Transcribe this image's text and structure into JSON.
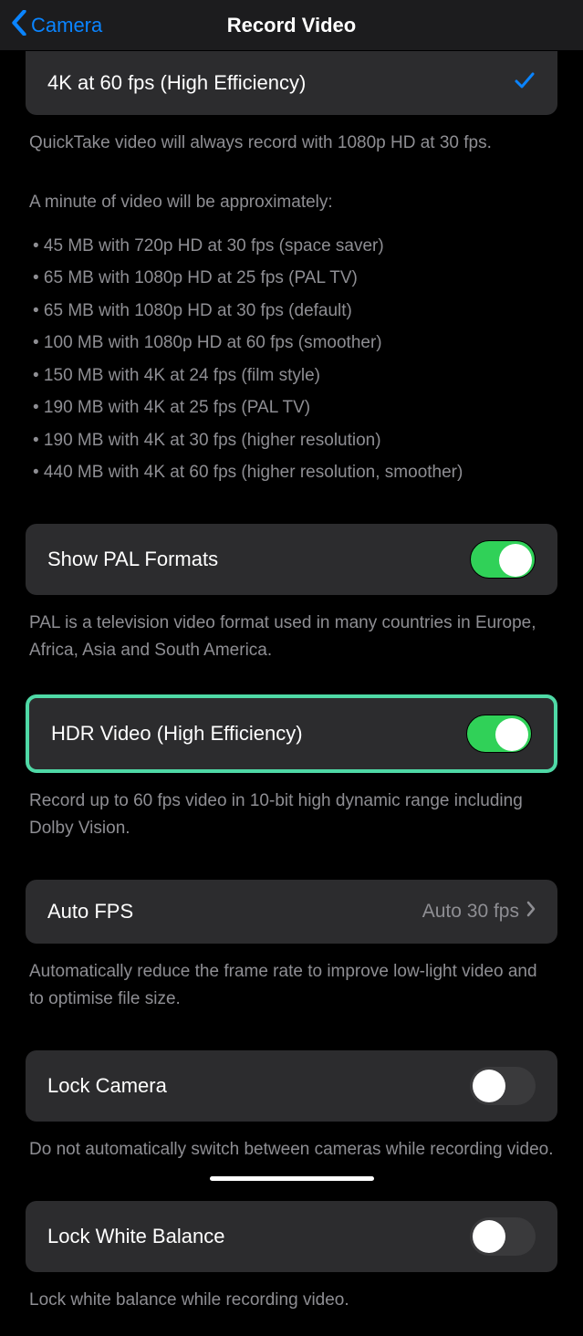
{
  "nav": {
    "back_label": "Camera",
    "title": "Record Video"
  },
  "selected_option": {
    "label": "4K at 60 fps (High Efficiency)"
  },
  "info": {
    "quicktake": "QuickTake video will always record with 1080p HD at 30 fps.",
    "intro": "A minute of video will be approximately:",
    "bullets": [
      "45 MB with 720p HD at 30 fps (space saver)",
      "65 MB with 1080p HD at 25 fps (PAL TV)",
      "65 MB with 1080p HD at 30 fps (default)",
      "100 MB with 1080p HD at 60 fps (smoother)",
      "150 MB with 4K at 24 fps (film style)",
      "190 MB with 4K at 25 fps (PAL TV)",
      "190 MB with 4K at 30 fps (higher resolution)",
      "440 MB with 4K at 60 fps (higher resolution, smoother)"
    ]
  },
  "pal": {
    "label": "Show PAL Formats",
    "on": true,
    "footer": "PAL is a television video format used in many countries in Europe, Africa, Asia and South America."
  },
  "hdr": {
    "label": "HDR Video (High Efficiency)",
    "on": true,
    "footer": "Record up to 60 fps video in 10-bit high dynamic range including Dolby Vision."
  },
  "autofps": {
    "label": "Auto FPS",
    "value": "Auto 30 fps",
    "footer": "Automatically reduce the frame rate to improve low-light video and to optimise file size."
  },
  "lockcamera": {
    "label": "Lock Camera",
    "on": false,
    "footer": "Do not automatically switch between cameras while recording video."
  },
  "lockwb": {
    "label": "Lock White Balance",
    "on": false,
    "footer": "Lock white balance while recording video."
  }
}
